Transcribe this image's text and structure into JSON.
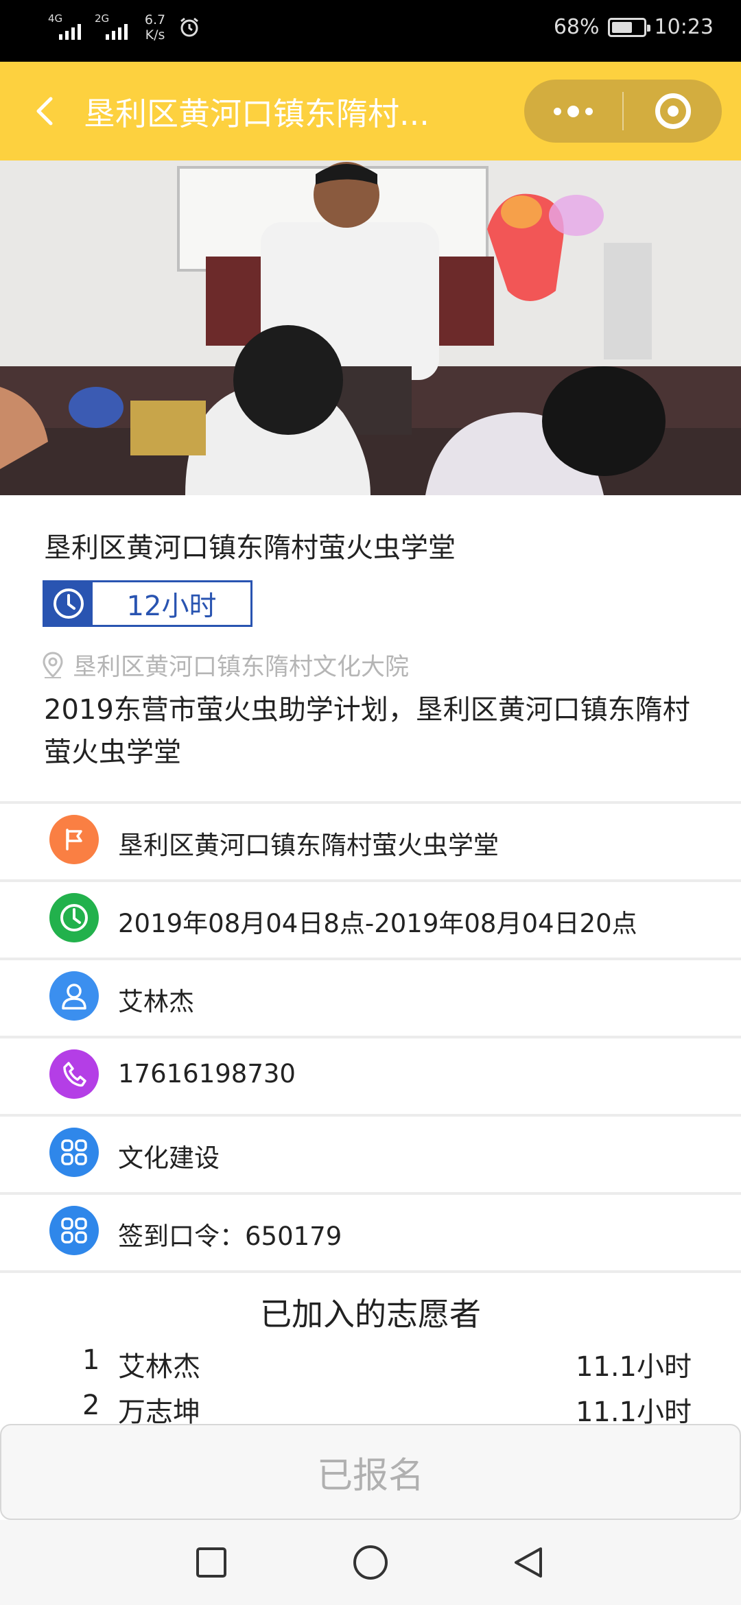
{
  "status_bar": {
    "network_1": "4G",
    "network_2": "2G",
    "speed_value": "6.7",
    "speed_unit": "K/s",
    "battery_percent": "68%",
    "battery_level": 0.68,
    "time": "10:23",
    "icons": [
      "signal-icon",
      "signal-icon",
      "alarm-icon",
      "battery-icon"
    ]
  },
  "header": {
    "title": "垦利区黄河口镇东隋村...",
    "bg_color": "#fdd13f",
    "capsule_color": "#d3ad3f"
  },
  "activity": {
    "name": "垦利区黄河口镇东隋村萤火虫学堂",
    "hours": "12小时",
    "location": "垦利区黄河口镇东隋村文化大院",
    "description": "2019东营市萤火虫助学计划，垦利区黄河口镇东隋村萤火虫学堂"
  },
  "details": [
    {
      "icon": "flag-icon",
      "color": "#fa7f43",
      "text": "垦利区黄河口镇东隋村萤火虫学堂"
    },
    {
      "icon": "clock-icon",
      "color": "#22b14c",
      "text": "2019年08月04日8点-2019年08月04日20点"
    },
    {
      "icon": "person-icon",
      "color": "#3b8fef",
      "text": "艾林杰"
    },
    {
      "icon": "phone-icon",
      "color": "#b43ee6",
      "text": "17616198730"
    },
    {
      "icon": "grid-icon",
      "color": "#2f87ea",
      "text": "文化建设"
    },
    {
      "icon": "grid-icon",
      "color": "#2f87ea",
      "text": "签到口令：650179"
    }
  ],
  "volunteers": {
    "title": "已加入的志愿者",
    "list": [
      {
        "no": "1",
        "name": "艾林杰",
        "hours": "11.1小时"
      },
      {
        "no": "2",
        "name": "万志坤",
        "hours": "11.1小时"
      }
    ]
  },
  "signup_button": {
    "label": "已报名"
  },
  "nav": [
    "recents-square-icon",
    "home-circle-icon",
    "back-triangle-icon"
  ]
}
